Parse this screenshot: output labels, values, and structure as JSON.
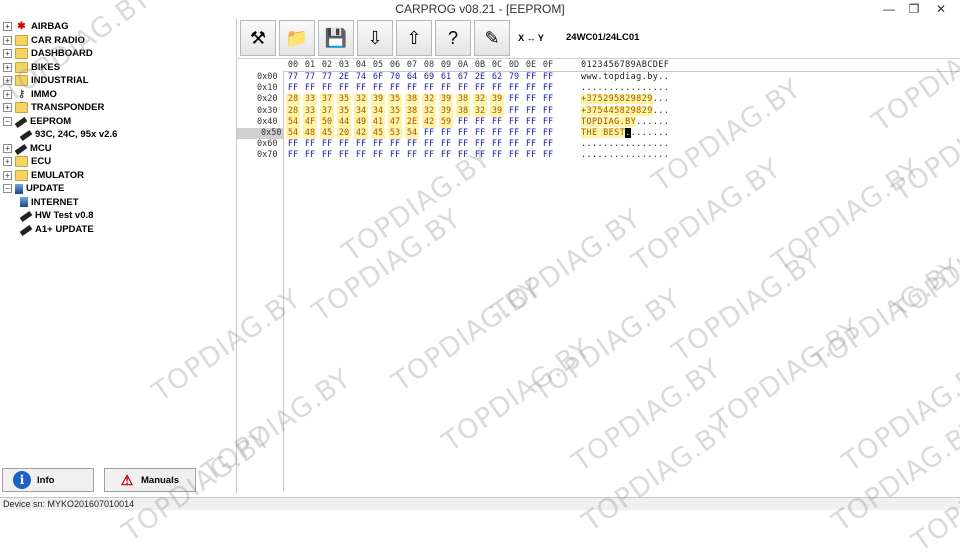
{
  "window": {
    "title": "CARPROG   v08.21 - [EEPROM]",
    "minimize": "—",
    "restore": "❐",
    "close": "✕"
  },
  "sidebar": {
    "tree": [
      {
        "label": "AIRBAG",
        "icon": "airbag-icon",
        "expander": "+"
      },
      {
        "label": "CAR RADIO",
        "icon": "folder-icon",
        "expander": "+"
      },
      {
        "label": "DASHBOARD",
        "icon": "folder-icon",
        "expander": "+"
      },
      {
        "label": "BIKES",
        "icon": "folder-icon",
        "expander": "+"
      },
      {
        "label": "INDUSTRIAL",
        "icon": "folder-icon",
        "expander": "+"
      },
      {
        "label": "IMMO",
        "icon": "immo-icon",
        "expander": "+"
      },
      {
        "label": "TRANSPONDER",
        "icon": "folder-icon",
        "expander": "+"
      },
      {
        "label": "EEPROM",
        "icon": "chip-icon",
        "expander": "−"
      },
      {
        "label": "93C, 24C, 95x v2.6",
        "icon": "chip-icon",
        "expander": ""
      },
      {
        "label": "MCU",
        "icon": "chip-icon",
        "expander": "+"
      },
      {
        "label": "ECU",
        "icon": "folder-icon",
        "expander": "+"
      },
      {
        "label": "EMULATOR",
        "icon": "folder-icon",
        "expander": "+"
      },
      {
        "label": "UPDATE",
        "icon": "update-icon",
        "expander": "−"
      },
      {
        "label": "INTERNET",
        "icon": "update-icon",
        "expander": ""
      },
      {
        "label": "HW Test v0.8",
        "icon": "chip-icon",
        "expander": ""
      },
      {
        "label": "A1+ UPDATE",
        "icon": "chip-icon",
        "expander": ""
      }
    ],
    "info_button": "Info",
    "info_icon": "i",
    "manuals_button": "Manuals",
    "manuals_icon": "⚠"
  },
  "toolbar": {
    "buttons": [
      {
        "name": "settings-tools-icon",
        "glyph": "⚒"
      },
      {
        "name": "open-folder-icon",
        "glyph": "📁"
      },
      {
        "name": "save-disk-icon",
        "glyph": "💾"
      },
      {
        "name": "read-chip-icon",
        "glyph": "⇩"
      },
      {
        "name": "write-chip-icon",
        "glyph": "⇧"
      },
      {
        "name": "verify-chip-icon",
        "glyph": "?"
      },
      {
        "name": "erase-chip-icon",
        "glyph": "✎"
      }
    ],
    "swap_label": "X ↔ Y",
    "chip_name": "24WC01/24LC01"
  },
  "hex": {
    "columns": [
      "00",
      "01",
      "02",
      "03",
      "04",
      "05",
      "06",
      "07",
      "08",
      "09",
      "0A",
      "0B",
      "0C",
      "0D",
      "0E",
      "0F"
    ],
    "ascii_header": "0123456789ABCDEF",
    "selected_row": "0x50",
    "rows": [
      {
        "addr": "0x00",
        "bytes": [
          "77",
          "77",
          "77",
          "2E",
          "74",
          "6F",
          "70",
          "64",
          "69",
          "61",
          "67",
          "2E",
          "62",
          "79",
          "FF",
          "FF"
        ],
        "ascii": "www.topdiag.by..",
        "hl": 0
      },
      {
        "addr": "0x10",
        "bytes": [
          "FF",
          "FF",
          "FF",
          "FF",
          "FF",
          "FF",
          "FF",
          "FF",
          "FF",
          "FF",
          "FF",
          "FF",
          "FF",
          "FF",
          "FF",
          "FF"
        ],
        "ascii": "................",
        "hl": 0
      },
      {
        "addr": "0x20",
        "bytes": [
          "28",
          "33",
          "37",
          "35",
          "32",
          "39",
          "35",
          "38",
          "32",
          "39",
          "38",
          "32",
          "39",
          "FF",
          "FF",
          "FF"
        ],
        "ascii": "+375295829829...",
        "hl": 13
      },
      {
        "addr": "0x30",
        "bytes": [
          "28",
          "33",
          "37",
          "35",
          "34",
          "34",
          "35",
          "38",
          "32",
          "39",
          "38",
          "32",
          "39",
          "FF",
          "FF",
          "FF"
        ],
        "ascii": "+375445829829...",
        "hl": 13
      },
      {
        "addr": "0x40",
        "bytes": [
          "54",
          "4F",
          "50",
          "44",
          "49",
          "41",
          "47",
          "2E",
          "42",
          "59",
          "FF",
          "FF",
          "FF",
          "FF",
          "FF",
          "FF"
        ],
        "ascii": "TOPDIAG.BY......",
        "hl": 10
      },
      {
        "addr": "0x50",
        "bytes": [
          "54",
          "48",
          "45",
          "20",
          "42",
          "45",
          "53",
          "54",
          "FF",
          "FF",
          "FF",
          "FF",
          "FF",
          "FF",
          "FF",
          "FF"
        ],
        "ascii": "THE BEST........",
        "hl": 8
      },
      {
        "addr": "0x60",
        "bytes": [
          "FF",
          "FF",
          "FF",
          "FF",
          "FF",
          "FF",
          "FF",
          "FF",
          "FF",
          "FF",
          "FF",
          "FF",
          "FF",
          "FF",
          "FF",
          "FF"
        ],
        "ascii": "................",
        "hl": 0
      },
      {
        "addr": "0x70",
        "bytes": [
          "FF",
          "FF",
          "FF",
          "FF",
          "FF",
          "FF",
          "FF",
          "FF",
          "FF",
          "FF",
          "FF",
          "FF",
          "FF",
          "FF",
          "FF",
          "FF"
        ],
        "ascii": "................",
        "hl": 0
      }
    ]
  },
  "status": {
    "device_sn": "Device sn: MYKO201607010014"
  },
  "watermark": "TOPDIAG.BY",
  "colors": {
    "hex_byte": "#1a1aa6",
    "highlight": "#fff3a8",
    "selected_row": "#d0d0d0",
    "info_blue": "#1e62c8"
  }
}
